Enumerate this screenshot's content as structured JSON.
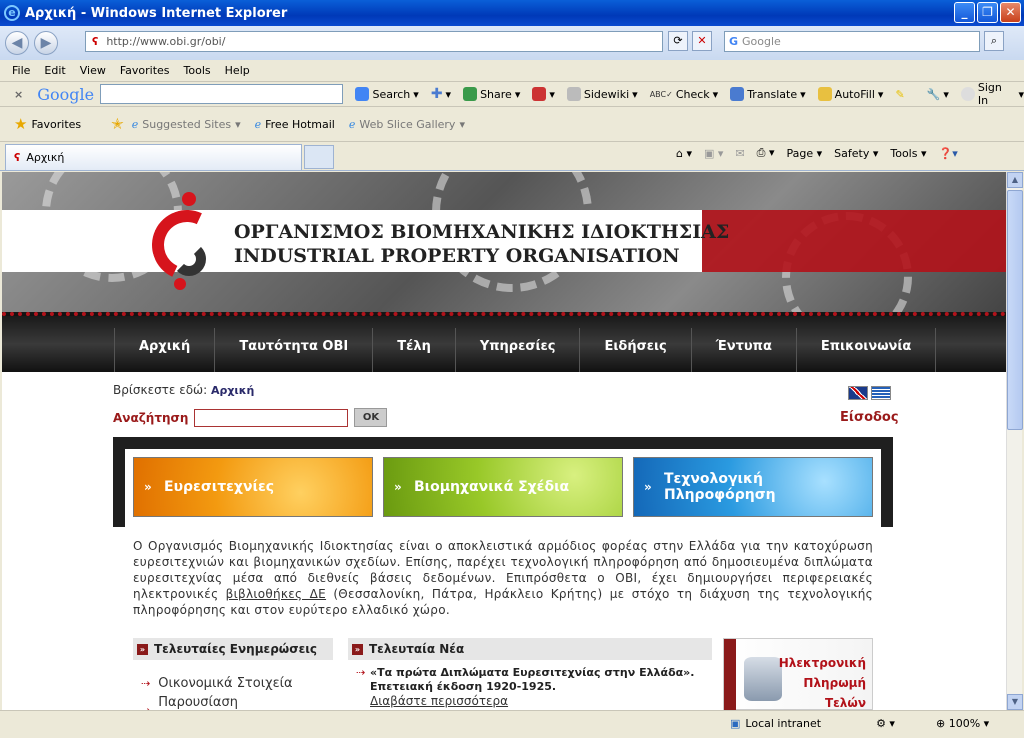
{
  "window": {
    "title": "Αρχική - Windows Internet Explorer",
    "url": "http://www.obi.gr/obi/",
    "search_placeholder": "Google"
  },
  "menu": [
    "File",
    "Edit",
    "View",
    "Favorites",
    "Tools",
    "Help"
  ],
  "google_toolbar": {
    "logo": "Google",
    "items": [
      "Search",
      "Share",
      "Sidewiki",
      "Check",
      "Translate",
      "AutoFill",
      "Sign In"
    ]
  },
  "favorites_bar": {
    "favorites": "Favorites",
    "items": [
      "Suggested Sites",
      "Free Hotmail",
      "Web Slice Gallery"
    ]
  },
  "tab": {
    "title": "Αρχική"
  },
  "command_bar": [
    "Page",
    "Safety",
    "Tools"
  ],
  "site": {
    "org_name_gr": "ΟΡΓΑΝΙΣΜΟΣ ΒΙΟΜΗΧΑΝΙΚΗΣ ΙΔΙΟΚΤΗΣΙΑΣ",
    "org_name_en": "INDUSTRIAL PROPERTY ORGANISATION",
    "nav": [
      "Αρχική",
      "Ταυτότητα ΟΒΙ",
      "Τέλη",
      "Υπηρεσίες",
      "Ειδήσεις",
      "Έντυπα",
      "Επικοινωνία"
    ],
    "breadcrumb_label": "Βρίσκεστε εδώ:",
    "breadcrumb_current": "Αρχική",
    "search_label": "Αναζήτηση",
    "search_button": "OK",
    "login": "Είσοδος",
    "features": [
      "Ευρεσιτεχνίες",
      "Βιομηχανικά Σχέδια",
      "Τεχνολογική Πληροφόρηση"
    ],
    "intro_1": "Ο Οργανισμός Βιομηχανικής Ιδιοκτησίας είναι ο αποκλειστικά αρμόδιος φορέας στην Ελλάδα για την κατοχύρωση ευρεσιτεχνιών και βιομηχανικών σχεδίων. Επίσης, παρέχει τεχνολογική πληροφόρηση από δημοσιευμένα διπλώματα ευρεσιτεχνίας μέσα από διεθνείς βάσεις δεδομένων. Επιπρόσθετα ο ΟΒΙ, έχει δημιουργήσει περιφερειακές ηλεκτρονικές ",
    "intro_link": "βιβλιοθήκες ΔΕ",
    "intro_2": " (Θεσσαλονίκη, Πάτρα, Ηράκλειο Κρήτης) με στόχο τη διάχυση της τεχνολογικής πληροφόρησης και στον ευρύτερο ελλαδικό χώρο.",
    "updates_title": "Τελευταίες Ενημερώσεις",
    "updates": [
      "Οικονομικά Στοιχεία",
      "Παρουσίαση Ηλεκτρονικών"
    ],
    "news_title": "Τελευταία Νέα",
    "news_item": "«Τα πρώτα Διπλώματα Ευρεσιτεχνίας στην Ελλάδα». Επετειακή έκδοση 1920-1925.",
    "news_more": "Διαβάστε περισσότερα",
    "pay_line1": "Ηλεκτρονική",
    "pay_line2": "Πληρωμή",
    "pay_line3": "Τελών"
  },
  "status": {
    "zone": "Local intranet",
    "zoom": "100%"
  }
}
